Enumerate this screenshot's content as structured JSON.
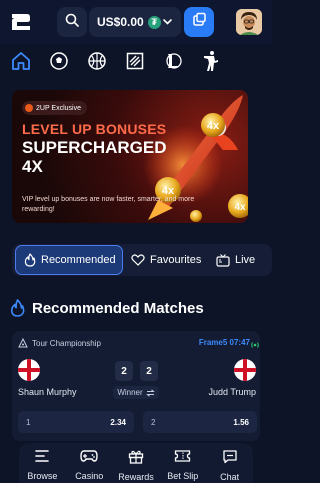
{
  "header": {
    "balance": "US$0.00",
    "coin_symbol": "₮",
    "icons": [
      "logo-icon",
      "search-icon",
      "chevron-down-icon",
      "deposit-icon",
      "avatar"
    ]
  },
  "sports_row": [
    "home-icon",
    "soccer-icon",
    "basketball-icon",
    "esports-icon",
    "lol-icon",
    "counter-strike-icon"
  ],
  "banner": {
    "badge": "2UP Exclusive",
    "line1": "LEVEL UP BONUSES",
    "line2": "SUPERCHARGED",
    "line3": "4X",
    "subtitle": "VIP level up bonuses are now faster, smarter, and more rewarding!",
    "accent_color": "#ff6b4a"
  },
  "tabs": [
    {
      "label": "Recommended",
      "icon": "flame-icon",
      "active": true
    },
    {
      "label": "Favourites",
      "icon": "heart-icon",
      "active": false
    },
    {
      "label": "Live",
      "icon": "tv-icon",
      "active": false
    }
  ],
  "section": {
    "title": "Recommended Matches"
  },
  "match": {
    "league": "Tour Championship",
    "status": "Frame5 07:47",
    "player1": "Shaun Murphy",
    "player2": "Judd Trump",
    "score1": "2",
    "score2": "2",
    "market": "Winner",
    "odds": [
      {
        "label": "1",
        "value": "2.34"
      },
      {
        "label": "2",
        "value": "1.56"
      }
    ]
  },
  "bottom_nav": [
    {
      "label": "Browse",
      "icon": "browse-icon"
    },
    {
      "label": "Casino",
      "icon": "gamepad-icon"
    },
    {
      "label": "Rewards",
      "icon": "gift-icon"
    },
    {
      "label": "Bet Slip",
      "icon": "ticket-icon"
    },
    {
      "label": "Chat",
      "icon": "chat-icon"
    }
  ],
  "colors": {
    "background": "#0d1428",
    "primary": "#2a7cf6",
    "live": "#3d8bff"
  }
}
